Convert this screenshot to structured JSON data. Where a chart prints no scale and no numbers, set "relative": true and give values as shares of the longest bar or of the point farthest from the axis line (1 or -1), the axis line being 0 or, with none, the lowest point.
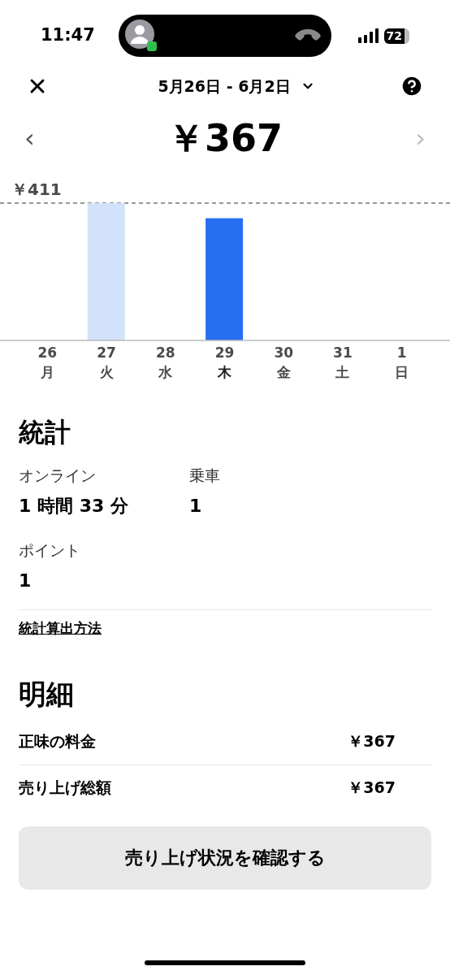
{
  "status_bar": {
    "time": "11:47",
    "battery": "72"
  },
  "header": {
    "date_range": "5月26日 - 6月2日",
    "prev": "‹",
    "next": "›",
    "total": "￥367"
  },
  "chart": {
    "chart_data": {
      "type": "bar",
      "categories": [
        "26",
        "27",
        "28",
        "29",
        "30",
        "31",
        "1"
      ],
      "values": [
        0,
        1,
        0,
        0.89,
        0,
        0,
        0
      ],
      "relative": true,
      "annotations": [
        {
          "text": "￥411"
        }
      ]
    },
    "days": [
      {
        "weekday": "月",
        "selected": false
      },
      {
        "weekday": "火",
        "selected": false
      },
      {
        "weekday": "水",
        "selected": false
      },
      {
        "weekday": "木",
        "selected": true
      },
      {
        "weekday": "金",
        "selected": false
      },
      {
        "weekday": "土",
        "selected": false
      },
      {
        "weekday": "日",
        "selected": false
      }
    ]
  },
  "stats": {
    "title": "統計",
    "items": [
      {
        "label": "オンライン",
        "value": "1 時間 33 分"
      },
      {
        "label": "乗車",
        "value": "1"
      },
      {
        "label": "ポイント",
        "value": "1"
      }
    ],
    "link": "統計算出方法"
  },
  "details": {
    "title": "明細",
    "rows": [
      {
        "label": "正味の料金",
        "value": "￥367"
      },
      {
        "label": "売り上げ総額",
        "value": "￥367"
      }
    ]
  },
  "button": "売り上げ状況を確認する"
}
